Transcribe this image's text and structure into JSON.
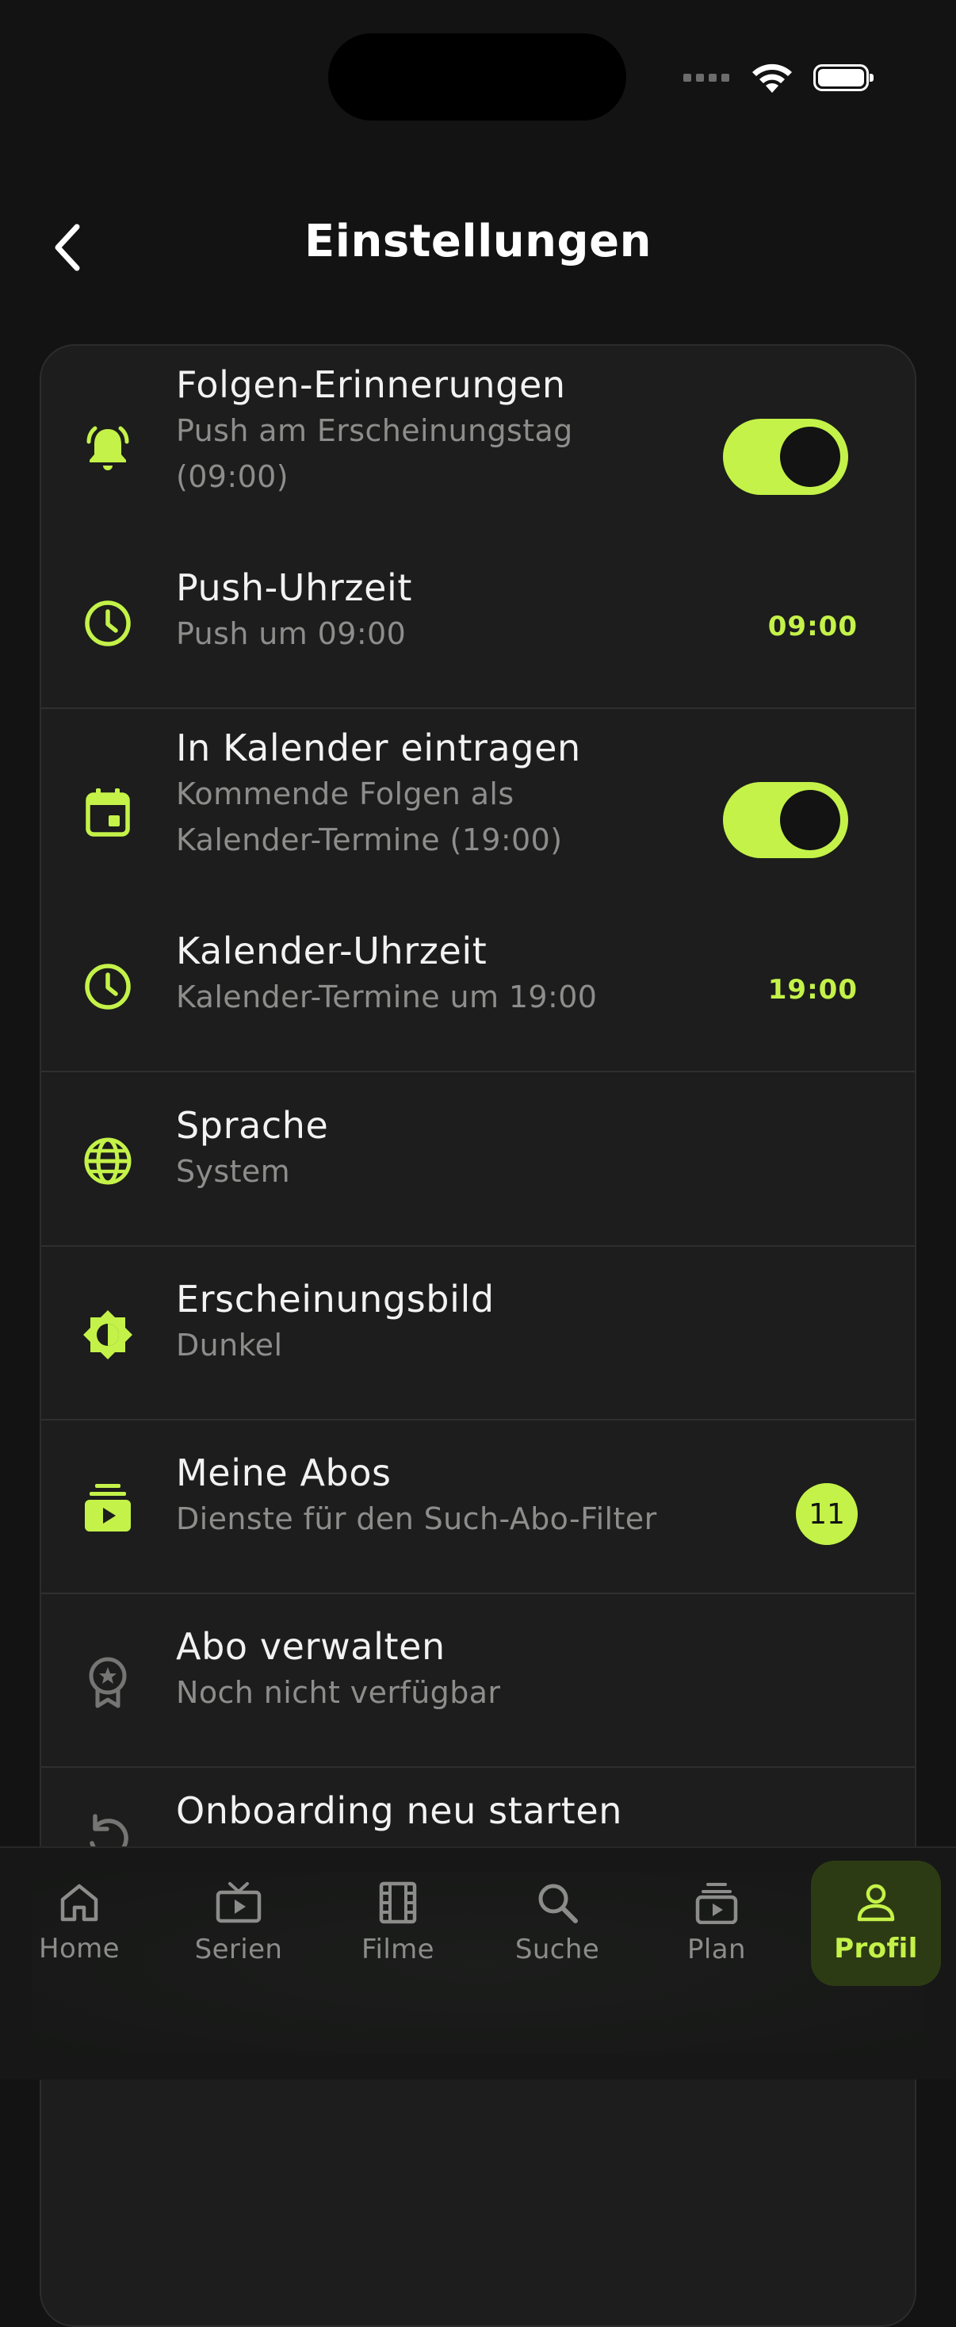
{
  "header": {
    "title": "Einstellungen"
  },
  "accent_color": "#c4f249",
  "settings": {
    "rows": [
      {
        "icon": "bell-ring-icon",
        "title": "Folgen-Erinnerungen",
        "subtitle_line1": "Push am Erscheinungstag",
        "subtitle_line2": "(09:00)",
        "toggle": "on"
      },
      {
        "icon": "clock-icon",
        "title": "Push-Uhrzeit",
        "subtitle": "Push um 09:00",
        "value": "09:00"
      },
      {
        "icon": "calendar-icon",
        "title": "In Kalender eintragen",
        "subtitle_line1": "Kommende Folgen als",
        "subtitle_line2": "Kalender-Termine (19:00)",
        "toggle": "on"
      },
      {
        "icon": "clock-icon",
        "title": "Kalender-Uhrzeit",
        "subtitle": "Kalender-Termine um 19:00",
        "value": "19:00"
      },
      {
        "icon": "globe-icon",
        "title": "Sprache",
        "subtitle": "System"
      },
      {
        "icon": "brightness-icon",
        "title": "Erscheinungsbild",
        "subtitle": "Dunkel"
      },
      {
        "icon": "subscriptions-icon",
        "title": "Meine Abos",
        "subtitle": "Dienste für den Such-Abo-Filter",
        "badge": "11"
      },
      {
        "icon": "award-icon",
        "title": "Abo verwalten",
        "subtitle": "Noch nicht verfügbar"
      },
      {
        "icon": "restart-icon",
        "title": "Onboarding neu starten"
      }
    ]
  },
  "tabs": [
    {
      "icon": "home-icon",
      "label": "Home"
    },
    {
      "icon": "tv-icon",
      "label": "Serien"
    },
    {
      "icon": "film-icon",
      "label": "Filme"
    },
    {
      "icon": "search-icon",
      "label": "Suche"
    },
    {
      "icon": "plan-icon",
      "label": "Plan"
    },
    {
      "icon": "person-icon",
      "label": "Profil",
      "active": true
    }
  ]
}
